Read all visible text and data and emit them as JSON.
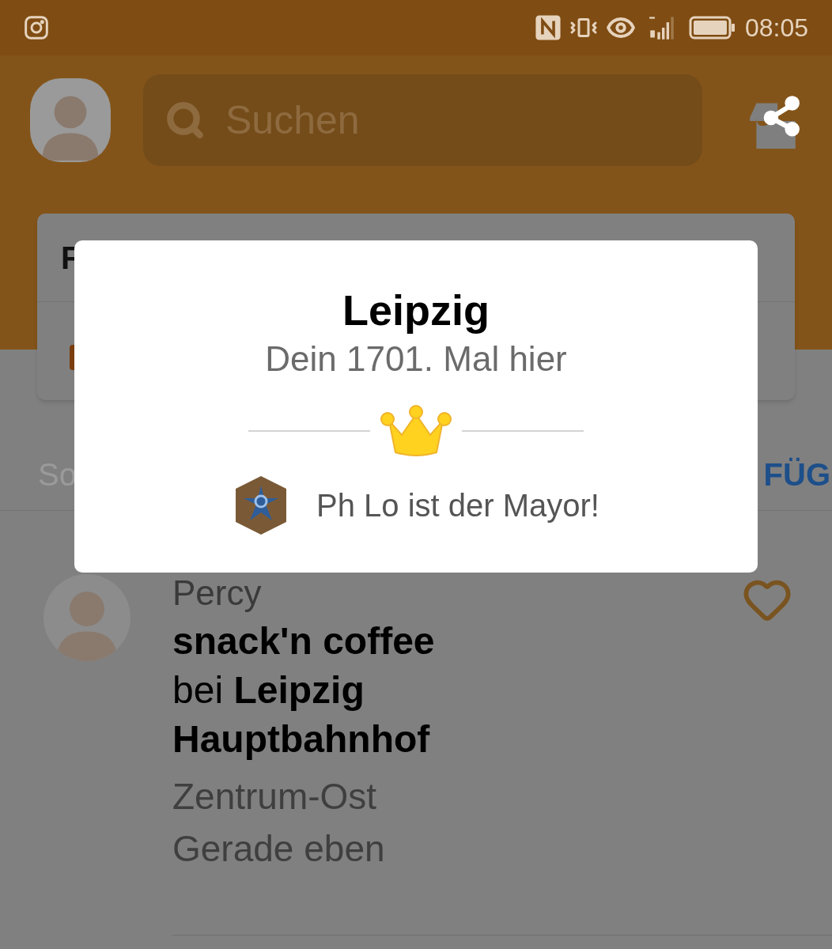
{
  "status_bar": {
    "time": "08:05"
  },
  "search": {
    "placeholder": "Suchen"
  },
  "card": {
    "title_fragment": "F"
  },
  "comment": {
    "placeholder": "So",
    "action": "FÜG"
  },
  "checkin": {
    "user": "Percy",
    "venue": "snack'n coffee",
    "location": "bei **Leipzig Hauptbahnhof**",
    "area": "Zentrum-Ost",
    "time": "Gerade eben",
    "liked": false
  },
  "dialog": {
    "title": "Leipzig",
    "subtitle": "Dein 1701. Mal hier",
    "mayor": "Ph Lo ist der Mayor!"
  }
}
